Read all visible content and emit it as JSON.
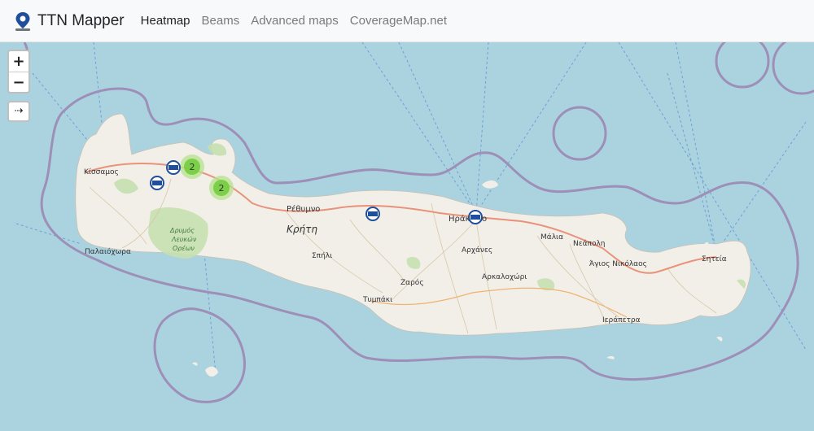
{
  "navbar": {
    "brand": "TTN Mapper",
    "links": [
      {
        "label": "Heatmap",
        "active": true
      },
      {
        "label": "Beams",
        "active": false
      },
      {
        "label": "Advanced maps",
        "active": false
      },
      {
        "label": "CoverageMap.net",
        "active": false
      }
    ]
  },
  "map_controls": {
    "zoom_in": "+",
    "zoom_out": "−",
    "expand": "⇢"
  },
  "map": {
    "colors": {
      "sea": "#aad3df",
      "land": "#f2efe9",
      "boundary": "#9e8fb8",
      "forest": "#b9d7a3",
      "road": "#e9927a"
    },
    "place_labels": {
      "kissamos": "Κίσσαμος",
      "rethymno": "Ρέθυμνο",
      "kriti": "Κρήτη",
      "heraklion": "Ηράκλειο",
      "malia": "Μάλια",
      "neapoli": "Νεάπολη",
      "agios_nikolaos": "Άγιος Νικόλαος",
      "siteia": "Σητεία",
      "archanes": "Αρχάνες",
      "arkalochori": "Αρκαλοχώρι",
      "spili": "Σπήλι",
      "zaros": "Ζαρός",
      "tympaki": "Τυμπάκι",
      "ierapetra": "Ιεράπετρα",
      "palaiochora": "Παλαιόχωρα",
      "park_1": "Δρυμός",
      "park_2": "Λευκών",
      "park_3": "Ορέων"
    },
    "clusters": [
      {
        "count": "2"
      },
      {
        "count": "2"
      }
    ],
    "gateway_icons": [
      "gateway-icon",
      "gateway-icon",
      "gateway-icon",
      "gateway-icon"
    ]
  }
}
